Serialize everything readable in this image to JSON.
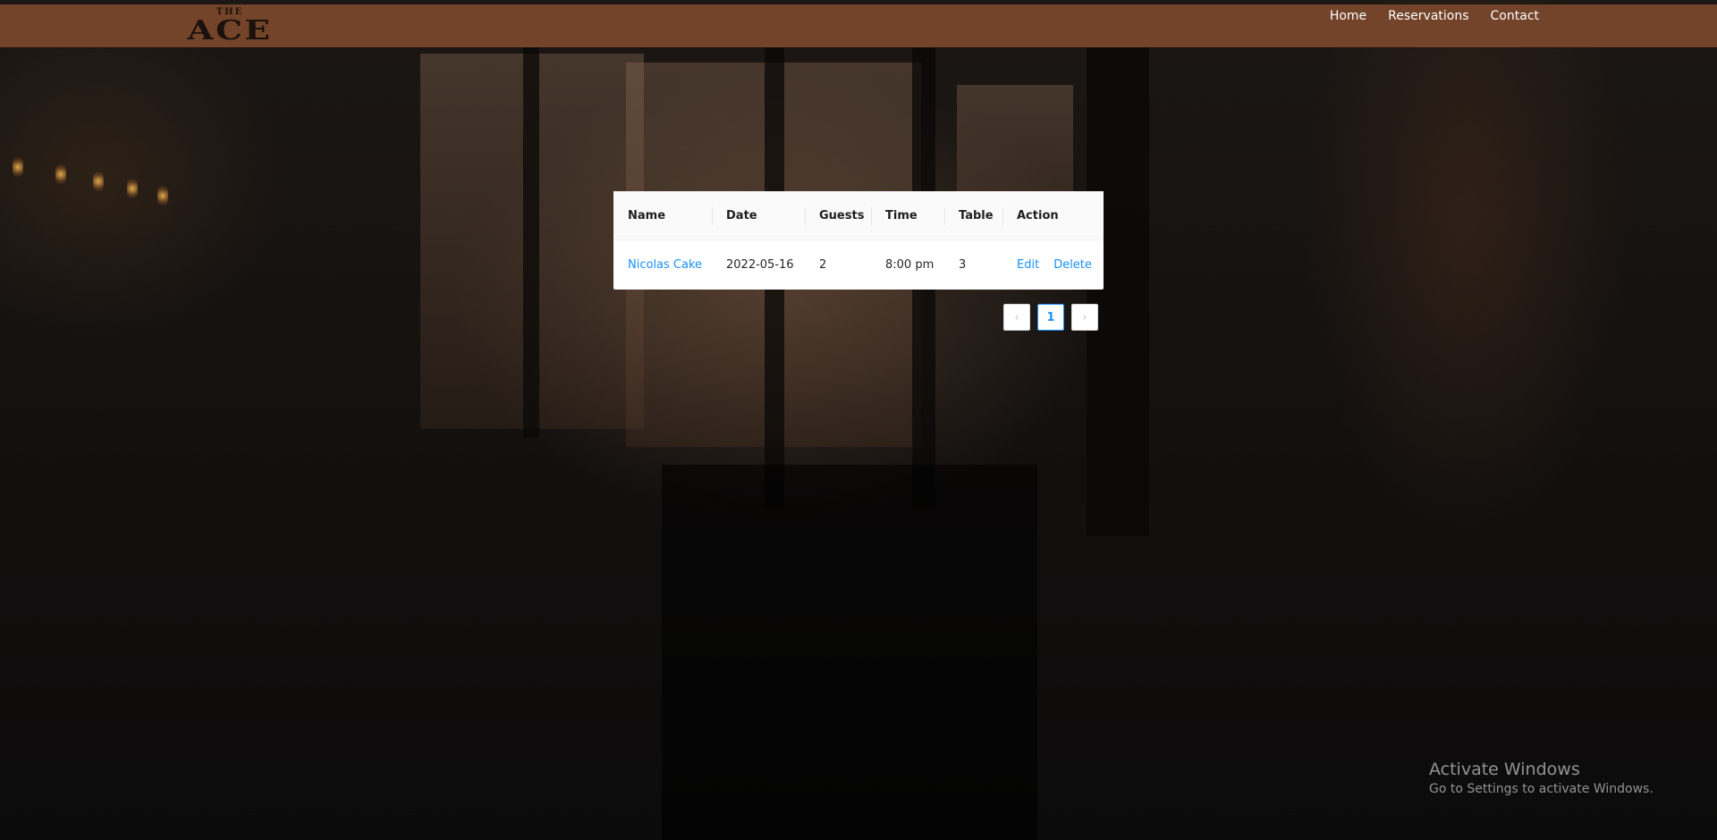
{
  "brand": {
    "logo_small": "THE",
    "logo_big": "ACE"
  },
  "nav": {
    "items": [
      {
        "label": "Home"
      },
      {
        "label": "Reservations"
      },
      {
        "label": "Contact"
      }
    ]
  },
  "reservations": {
    "columns": [
      "Name",
      "Date",
      "Guests",
      "Time",
      "Table",
      "Action"
    ],
    "rows": [
      {
        "name": "Nicolas Cake",
        "date": "2022-05-16",
        "guests": "2",
        "time": "8:00 pm",
        "table": "3",
        "actions": {
          "edit": "Edit",
          "delete": "Delete"
        }
      }
    ]
  },
  "pagination": {
    "prev_icon": "‹",
    "current_page": "1",
    "next_icon": "›"
  },
  "watermark": {
    "title": "Activate Windows",
    "subtitle": "Go to Settings to activate Windows."
  },
  "colors": {
    "navbar": "#73432a",
    "link": "#1890ff"
  }
}
